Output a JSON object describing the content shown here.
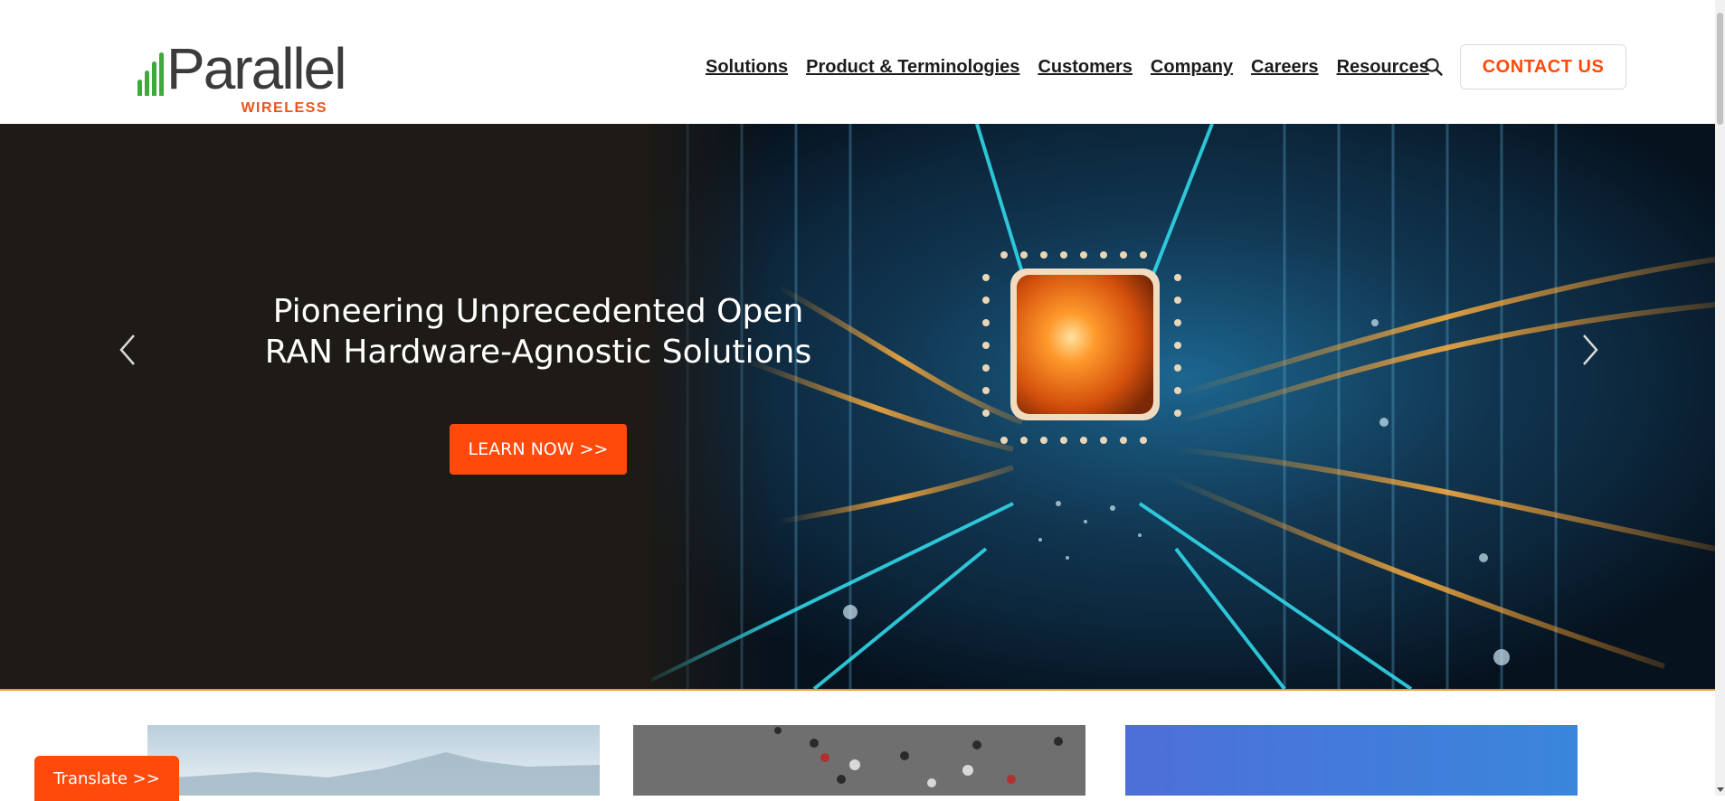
{
  "header": {
    "logo": {
      "name": "Parallel",
      "sub": "WIRELESS",
      "icon": "signal-bars-logo"
    },
    "nav": [
      "Solutions",
      "Product & Terminologies",
      "Customers",
      "Company",
      "Careers",
      "Resources"
    ],
    "search_icon": "search-icon",
    "contact_label": "CONTACT US"
  },
  "hero": {
    "title": "Pioneering Unprecedented Open RAN Hardware-Agnostic Solutions",
    "cta_label": "LEARN NOW >>",
    "prev_icon": "chevron-left-icon",
    "next_icon": "chevron-right-icon"
  },
  "translate": {
    "label": "Translate >>"
  },
  "colors": {
    "brand_orange": "#ff4a0c",
    "logo_green": "#3cab3c",
    "logo_sub_orange": "#e8551a",
    "hero_bg": "#1e1a16"
  }
}
